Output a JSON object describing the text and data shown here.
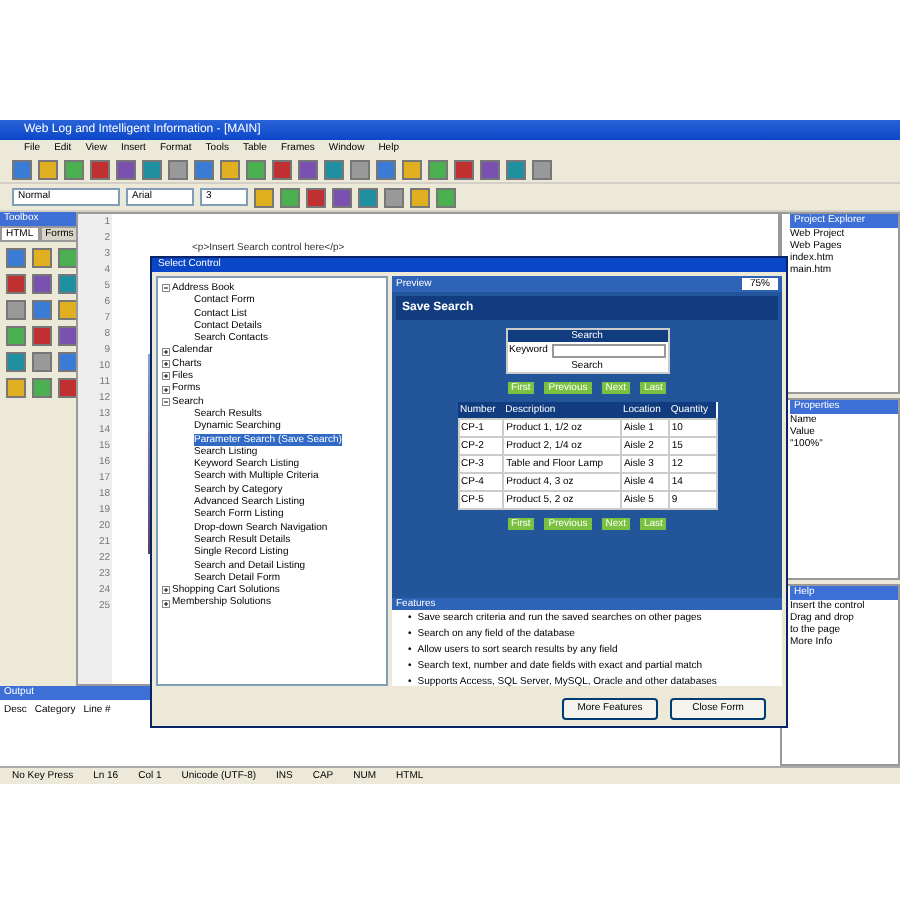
{
  "window": {
    "title": "Web Log and Intelligent Information - [MAIN]"
  },
  "menu": [
    "File",
    "Edit",
    "View",
    "Insert",
    "Format",
    "Tools",
    "Table",
    "Frames",
    "Window",
    "Help"
  ],
  "toolbar_fields": [
    {
      "value": "Normal"
    },
    {
      "value": "Arial"
    },
    {
      "value": "3"
    }
  ],
  "editor": {
    "line_numbers": [
      "1",
      "2",
      "3",
      "4",
      "5",
      "6",
      "7",
      "8",
      "9",
      "10",
      "11",
      "12",
      "13",
      "14",
      "15",
      "16",
      "17",
      "18",
      "19",
      "20",
      "21",
      "22",
      "23",
      "24",
      "25"
    ],
    "code_line": "<p>Insert Search control here</p>"
  },
  "toolbox": {
    "title": "Toolbox",
    "tabs": [
      {
        "label": "HTML",
        "selected": true
      },
      {
        "label": "Forms",
        "selected": false
      }
    ]
  },
  "output": {
    "title": "Output",
    "columns": [
      "Desc",
      "Category",
      "Line #"
    ]
  },
  "right_panels": [
    {
      "title": "Project Explorer",
      "lines": [
        "Web Project",
        "Web Pages",
        "index.htm",
        "main.htm"
      ]
    },
    {
      "title": "Properties",
      "lines": [
        "Name",
        "Value",
        "\"100%\""
      ]
    },
    {
      "title": "Help",
      "lines": [
        "Insert the control",
        "Drag and drop",
        "to the page",
        "More Info"
      ]
    }
  ],
  "status_bar": [
    "No Key Press",
    "Ln 16",
    "Col 1",
    "Unicode (UTF-8)",
    "INS",
    "CAP",
    "NUM",
    "HTML"
  ],
  "dialog": {
    "title": "Select Control",
    "tree": [
      {
        "label": "Address Book",
        "expanded": true,
        "selected": false,
        "children": [
          {
            "label": "Contact Form",
            "selected": false
          },
          {
            "label": "Contact List",
            "selected": false
          },
          {
            "label": "Contact Details",
            "selected": false
          },
          {
            "label": "Search Contacts",
            "selected": false
          }
        ]
      },
      {
        "label": "Calendar",
        "expanded": false,
        "selected": false
      },
      {
        "label": "Charts",
        "expanded": false,
        "selected": false
      },
      {
        "label": "Files",
        "expanded": false,
        "selected": false
      },
      {
        "label": "Forms",
        "expanded": false,
        "selected": false
      },
      {
        "label": "Search",
        "expanded": true,
        "selected": false,
        "children": [
          {
            "label": "Search Results",
            "selected": false
          },
          {
            "label": "Dynamic Searching",
            "selected": false
          },
          {
            "label": "Parameter Search (Save Search)",
            "selected": true
          },
          {
            "label": "Search Listing",
            "selected": false
          },
          {
            "label": "Keyword Search Listing",
            "selected": false
          },
          {
            "label": "Search with Multiple Criteria",
            "selected": false
          },
          {
            "label": "Search by Category",
            "selected": false
          },
          {
            "label": "Advanced Search Listing",
            "selected": false
          },
          {
            "label": "Search Form Listing",
            "selected": false
          },
          {
            "label": "Drop-down Search Navigation",
            "selected": false
          },
          {
            "label": "Search Result Details",
            "selected": false
          },
          {
            "label": "Single Record Listing",
            "selected": false
          },
          {
            "label": "Search and Detail Listing",
            "selected": false
          },
          {
            "label": "Search Detail Form",
            "selected": false
          }
        ]
      },
      {
        "label": "Shopping Cart Solutions",
        "expanded": false,
        "selected": false
      },
      {
        "label": "Membership Solutions",
        "expanded": false,
        "selected": false
      }
    ],
    "preview": {
      "title": "Preview",
      "zoom": "75%",
      "heading": "Save Search",
      "form": {
        "title": "Search",
        "label": "Keyword",
        "button": "Search"
      },
      "pager": [
        "First",
        "Previous",
        "Next",
        "Last"
      ],
      "table": {
        "columns": [
          "Number",
          "Description",
          "Location",
          "Quantity"
        ],
        "rows": [
          [
            "CP-1",
            "Product 1, 1/2 oz",
            "Aisle 1",
            "10"
          ],
          [
            "CP-2",
            "Product 2, 1/4 oz",
            "Aisle 2",
            "15"
          ],
          [
            "CP-3",
            "Table and Floor Lamp",
            "Aisle 3",
            "12"
          ],
          [
            "CP-4",
            "Product 4, 3 oz",
            "Aisle 4",
            "14"
          ],
          [
            "CP-5",
            "Product 5, 2 oz",
            "Aisle 5",
            "9"
          ]
        ]
      },
      "pager_bottom": [
        "First",
        "Previous",
        "Next",
        "Last"
      ]
    },
    "features": {
      "title": "Features",
      "bullet": "•",
      "items": [
        "Save search criteria and run the saved searches on other pages",
        "Search on any field of the database",
        "Allow users to sort search results by any field",
        "Search text, number and date fields with exact and partial match",
        "Supports Access, SQL Server, MySQL, Oracle and other databases"
      ]
    },
    "buttons": [
      "More Features",
      "Close Form"
    ]
  }
}
